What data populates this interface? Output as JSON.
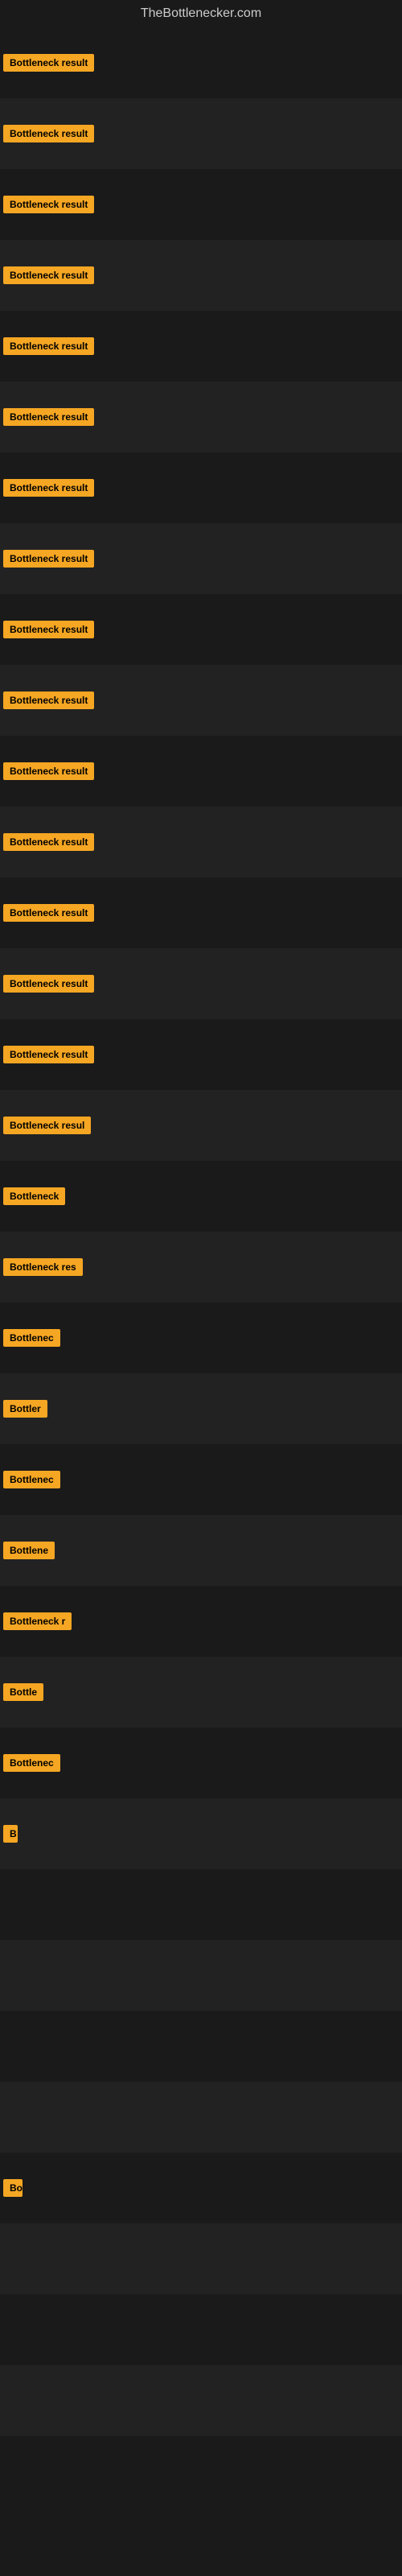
{
  "site": {
    "title": "TheBottlenecker.com"
  },
  "rows": [
    {
      "label": "Bottleneck result",
      "width": 130
    },
    {
      "label": "Bottleneck result",
      "width": 130
    },
    {
      "label": "Bottleneck result",
      "width": 130
    },
    {
      "label": "Bottleneck result",
      "width": 130
    },
    {
      "label": "Bottleneck result",
      "width": 130
    },
    {
      "label": "Bottleneck result",
      "width": 130
    },
    {
      "label": "Bottleneck result",
      "width": 130
    },
    {
      "label": "Bottleneck result",
      "width": 130
    },
    {
      "label": "Bottleneck result",
      "width": 130
    },
    {
      "label": "Bottleneck result",
      "width": 130
    },
    {
      "label": "Bottleneck result",
      "width": 130
    },
    {
      "label": "Bottleneck result",
      "width": 130
    },
    {
      "label": "Bottleneck result",
      "width": 130
    },
    {
      "label": "Bottleneck result",
      "width": 130
    },
    {
      "label": "Bottleneck result",
      "width": 130
    },
    {
      "label": "Bottleneck resul",
      "width": 115
    },
    {
      "label": "Bottleneck",
      "width": 80
    },
    {
      "label": "Bottleneck res",
      "width": 100
    },
    {
      "label": "Bottlenec",
      "width": 72
    },
    {
      "label": "Bottler",
      "width": 56
    },
    {
      "label": "Bottlenec",
      "width": 72
    },
    {
      "label": "Bottlene",
      "width": 64
    },
    {
      "label": "Bottleneck r",
      "width": 90
    },
    {
      "label": "Bottle",
      "width": 50
    },
    {
      "label": "Bottlenec",
      "width": 72
    },
    {
      "label": "B",
      "width": 18
    },
    {
      "label": "",
      "width": 4
    },
    {
      "label": "",
      "width": 0
    },
    {
      "label": "",
      "width": 0
    },
    {
      "label": "",
      "width": 0
    },
    {
      "label": "Bo",
      "width": 24
    },
    {
      "label": "",
      "width": 0
    },
    {
      "label": "",
      "width": 0
    },
    {
      "label": "",
      "width": 0
    },
    {
      "label": "",
      "width": 0
    }
  ]
}
